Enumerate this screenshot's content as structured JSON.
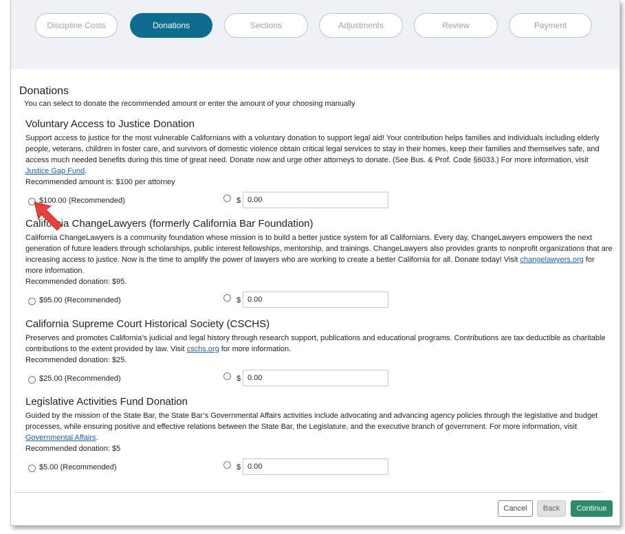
{
  "stepper": {
    "steps": [
      {
        "label": "Discipline Costs",
        "active": false
      },
      {
        "label": "Donations",
        "active": true
      },
      {
        "label": "Sections",
        "active": false
      },
      {
        "label": "Adjustments",
        "active": false
      },
      {
        "label": "Review",
        "active": false
      },
      {
        "label": "Payment",
        "active": false
      }
    ]
  },
  "page": {
    "title": "Donations",
    "subtitle": "You can select to donate the recommended amount or enter the amount of your choosing manually"
  },
  "donations": [
    {
      "title": "Voluntary Access to Justice Donation",
      "body_before_link": "Support access to justice for the most vulnerable Californians with a voluntary donation to support legal aid! Your contribution helps families and individuals including elderly people, veterans, children in foster care, and survivors of domestic violence obtain critical legal services to stay in their homes, keep their families and themselves safe, and access much needed benefits during this time of great need. Donate now and urge other attorneys to donate. (See Bus. & Prof. Code §6033.) For more information, visit ",
      "link": "Justice Gap Fund",
      "body_after_link": ".",
      "recommended_line": "Recommended amount is: $100 per attorney",
      "option_label": "$100.00 (Recommended)",
      "currency": "$",
      "custom_value": "0.00"
    },
    {
      "title": "California ChangeLawyers (formerly California Bar Foundation)",
      "body_before_link": "California ChangeLawyers is a community foundation whose mission is to build a better justice system for all Californians. Every day, ChangeLawyers empowers the next generation of future leaders through scholarships, public interest fellowships, mentorship, and trainings. ChangeLawyers also provides grants to nonprofit organizations that are increasing access to justice. Now is the time to amplify the power of lawyers who are working to create a better California for all. Donate today! Visit ",
      "link": "changelawyers.org",
      "body_after_link": " for more information.",
      "recommended_line": "Recommended donation: $95.",
      "option_label": "$95.00 (Recommended)",
      "currency": "$",
      "custom_value": "0.00"
    },
    {
      "title": "California Supreme Court Historical Society (CSCHS)",
      "body_before_link": "Preserves and promotes California’s judicial and legal history through research support, publications and educational programs. Contributions are tax deductible as charitable contributions to the extent provided by law. Visit ",
      "link": "cschs.org",
      "body_after_link": " for more information.",
      "recommended_line": "Recommended donation: $25.",
      "option_label": "$25.00 (Recommended)",
      "currency": "$",
      "custom_value": "0.00"
    },
    {
      "title": "Legislative Activities Fund Donation",
      "body_before_link": "Guided by the mission of the State Bar, the State Bar’s Governmental Affairs activities include advocating and advancing agency policies through the legislative and budget processes, while ensuring positive and effective relations between the State Bar, the Legislature, and the executive branch of government. For more information, visit ",
      "link": "Governmental Affairs",
      "body_after_link": ".",
      "recommended_line": "Recommended donation: $5",
      "option_label": "$5.00 (Recommended)",
      "currency": "$",
      "custom_value": "0.00"
    }
  ],
  "actions": {
    "cancel": "Cancel",
    "back": "Back",
    "continue": "Continue"
  },
  "colors": {
    "active_step": "#0e6c8e",
    "continue_button": "#2e8a6c",
    "link": "#1a5fb4",
    "cursor_arrow": "#e8413c"
  },
  "icons": {
    "cursor": "arrow-cursor-icon"
  }
}
